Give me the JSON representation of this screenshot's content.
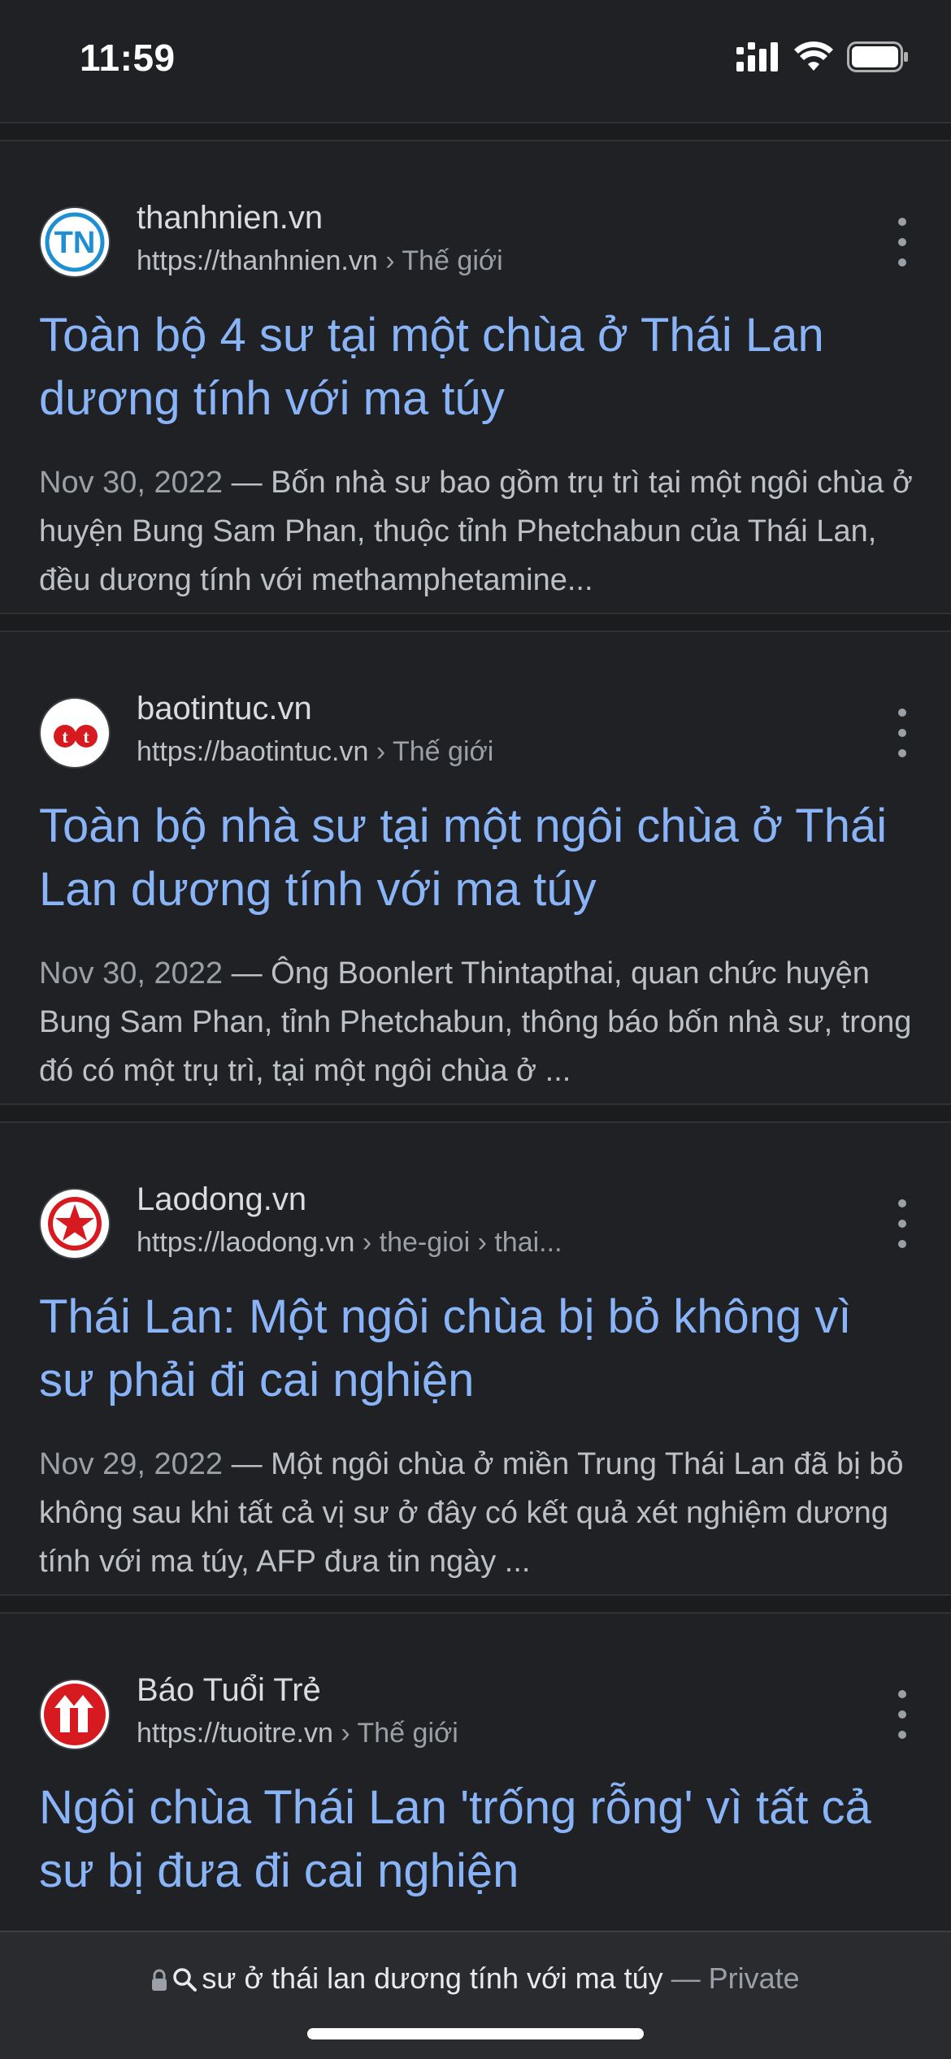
{
  "status_bar": {
    "time": "11:59"
  },
  "results": [
    {
      "site_name": "thanhnien.vn",
      "url": "https://thanhnien.vn",
      "breadcrumb": " › Thế giới",
      "title": "Toàn bộ 4 sư tại một chùa ở Thái Lan dương tính với ma túy",
      "date": "Nov 30, 2022",
      "snippet": " — Bốn nhà sư bao gồm trụ trì tại một ngôi chùa ở huyện Bung Sam Phan, thuộc tỉnh Phetchabun của Thái Lan, đều dương tính với methamphetamine...",
      "favicon_text": "TN",
      "favicon_color": "#1f8fd4",
      "favicon_icon": "thanhnien-logo-icon"
    },
    {
      "site_name": "baotintuc.vn",
      "url": "https://baotintuc.vn",
      "breadcrumb": " › Thế giới",
      "title": "Toàn bộ nhà sư tại một ngôi chùa ở Thái Lan dương tính với ma túy",
      "date": "Nov 30, 2022",
      "snippet": " — Ông Boonlert Thintapthai, quan chức huyện Bung Sam Phan, tỉnh Phetchabun, thông báo bốn nhà sư, trong đó có một trụ trì, tại một ngôi chùa ở ...",
      "favicon_text": "t·t",
      "favicon_color": "#d71920",
      "favicon_icon": "baotintuc-logo-icon"
    },
    {
      "site_name": "Laodong.vn",
      "url": "https://laodong.vn",
      "breadcrumb": " › the-gioi › thai...",
      "title": "Thái Lan: Một ngôi chùa bị bỏ không vì sư phải đi cai nghiện",
      "date": "Nov 29, 2022",
      "snippet": " — Một ngôi chùa ở miền Trung Thái Lan đã bị bỏ không sau khi tất cả vị sư ở đây có kết quả xét nghiệm dương tính với ma túy, AFP đưa tin ngày ...",
      "favicon_color": "#d71920",
      "favicon_icon": "laodong-star-icon"
    },
    {
      "site_name": "Báo Tuổi Trẻ",
      "url": "https://tuoitre.vn",
      "breadcrumb": " › Thế giới",
      "title": "Ngôi chùa Thái Lan 'trống rỗng' vì tất cả sư bị đưa đi cai nghiện",
      "favicon_color": "#d71920",
      "favicon_icon": "tuoitre-logo-icon"
    }
  ],
  "bottom_bar": {
    "lock_icon": "lock-icon",
    "search_icon": "search-icon",
    "query": "sư ở thái lan dương tính với ma túy",
    "private_label": " — Private"
  }
}
